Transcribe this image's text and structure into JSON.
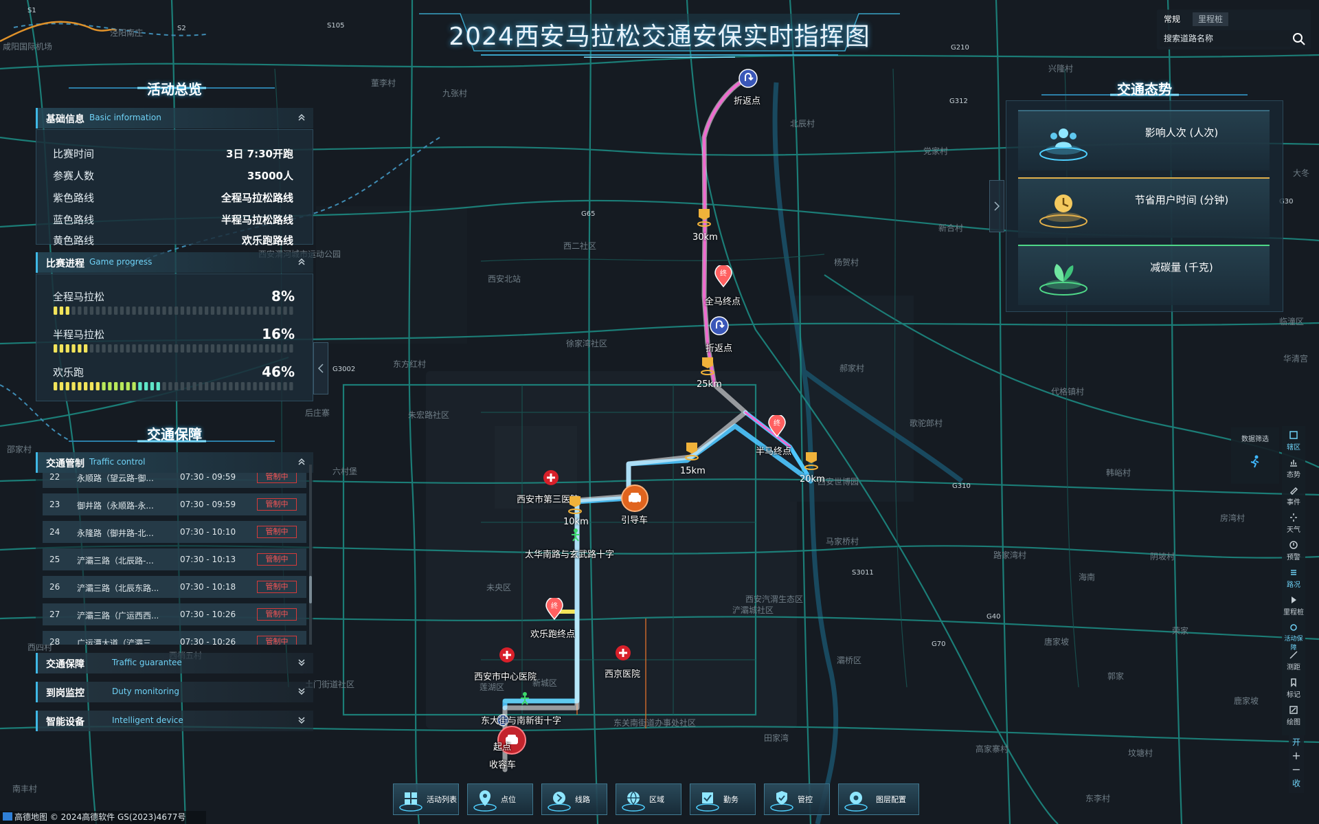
{
  "title": "2024西安马拉松交通安保实时指挥图",
  "search": {
    "tabs": [
      "常规",
      "里程桩"
    ],
    "placeholder": "搜索道路名称"
  },
  "left": {
    "activity_title": "活动总览",
    "basic": {
      "title_zh": "基础信息",
      "title_en": "Basic information",
      "rows": [
        {
          "key": "比赛时间",
          "value": "3日 7:30开跑"
        },
        {
          "key": "参赛人数",
          "value": "35000人"
        },
        {
          "key": "紫色路线",
          "value": "全程马拉松路线"
        },
        {
          "key": "蓝色路线",
          "value": "半程马拉松路线"
        },
        {
          "key": "黄色路线",
          "value": "欢乐跑路线"
        }
      ]
    },
    "progress": {
      "title_zh": "比赛进程",
      "title_en": "Game progress",
      "rows": [
        {
          "key": "全程马拉松",
          "value": "8%",
          "fraction": 0.08
        },
        {
          "key": "半程马拉松",
          "value": "16%",
          "fraction": 0.16
        },
        {
          "key": "欢乐跑",
          "value": "46%",
          "fraction": 0.46
        }
      ]
    },
    "traffic_title": "交通保障",
    "control": {
      "title_zh": "交通管制",
      "title_en": "Traffic control",
      "rows": [
        {
          "no": "22",
          "road": "永顺路（望云路-御...",
          "time": "07:30 - 09:59",
          "status": "管制中"
        },
        {
          "no": "23",
          "road": "御井路（永顺路-永...",
          "time": "07:30 - 09:59",
          "status": "管制中"
        },
        {
          "no": "24",
          "road": "永隆路（御井路-北...",
          "time": "07:30 - 10:10",
          "status": "管制中"
        },
        {
          "no": "25",
          "road": "浐灞三路（北辰路-...",
          "time": "07:30 - 10:13",
          "status": "管制中"
        },
        {
          "no": "26",
          "road": "浐灞三路（北辰东路...",
          "time": "07:30 - 10:18",
          "status": "管制中"
        },
        {
          "no": "27",
          "road": "浐灞三路（广运西西...",
          "time": "07:30 - 10:26",
          "status": "管制中"
        },
        {
          "no": "28",
          "road": "广运潭大道（浐灞三...",
          "time": "07:30 - 10:26",
          "status": "管制中"
        }
      ]
    },
    "folds": [
      {
        "zh": "交通保障",
        "en": "Traffic guarantee"
      },
      {
        "zh": "到岗监控",
        "en": "Duty monitoring"
      },
      {
        "zh": "智能设备",
        "en": "Intelligent device"
      }
    ]
  },
  "right": {
    "title": "交通态势",
    "cards": [
      {
        "label": "影响人次 (人次)",
        "icon": "people-icon"
      },
      {
        "label": "节省用户时间 (分钟)",
        "icon": "clock-icon"
      },
      {
        "label": "减碳量 (千克)",
        "icon": "leaf-icon"
      }
    ]
  },
  "toolbar": {
    "data_filter": "数据筛选",
    "items": [
      "辖区",
      "态势",
      "事件",
      "天气",
      "预警",
      "路况",
      "里程桩",
      "活动保障",
      "测距",
      "标记",
      "绘图"
    ],
    "zoom": [
      "开",
      "+",
      "−",
      "收"
    ]
  },
  "bottom_nav": [
    "活动列表",
    "点位",
    "线路",
    "区域",
    "勤务",
    "管控",
    "图层配置"
  ],
  "copyright": "高德地图 © 2024高德软件 GS(2023)4677号",
  "markers": {
    "turn_top": "折返点",
    "turn_mid": "折返点",
    "full_finish": "全马终点",
    "half_finish": "半马终点",
    "fun_finish": "欢乐跑终点",
    "guide_car": "引导车",
    "start": "起点",
    "sweep_car": "收容车",
    "hospital_3": "西安市第三医院",
    "hospital_center": "西安市中心医院",
    "hospital_xijing": "西京医院",
    "cross_taihua": "太华南路与玄武路十字",
    "cross_dongda": "东大街与南新街十字",
    "km": [
      "30km",
      "25km",
      "20km",
      "15km",
      "10km"
    ]
  },
  "map_labels": [
    "咸阳国际机场",
    "泾阳南庄",
    "西安北站",
    "西安世博园",
    "灞桥区",
    "莲湖区",
    "新城区",
    "未央区",
    "北辰村",
    "兴隆村",
    "党家村",
    "新合村",
    "杨贺村",
    "郝家村",
    "歌驼郎村",
    "韩峪村",
    "马家桥村",
    "西安汽渭生态区",
    "浐灞城社区",
    "路家湾村",
    "海南",
    "唐家坡",
    "郭家",
    "田家湾",
    "高家寨村",
    "坟塘村",
    "东李村",
    "南丰村",
    "后庄寨",
    "东方红村",
    "徐家湾社区",
    "朱宏路社区",
    "西安渭河城市运动公园",
    "六村堡",
    "九张村",
    "董李村",
    "邵家村",
    "西二社区",
    "临潼区",
    "华清宫",
    "大冬",
    "东关南街道办事处社区",
    "土门街道社区",
    "西四村",
    "西梢五村",
    "代格镇村",
    "房湾村",
    "阴坡村",
    "荣家",
    "鹿家坡"
  ],
  "road_codes": [
    "S1",
    "S105",
    "G312",
    "G210",
    "G65",
    "G3002",
    "S3011",
    "G310",
    "G40",
    "G70",
    "G30",
    "S2"
  ],
  "colors": {
    "full_route": "#f06ad0",
    "half_route": "#4fc7ff",
    "fun_route": "#f2e45a",
    "road": "#1d8f86",
    "accent": "#3fb8e6",
    "alert": "#ff5656"
  }
}
